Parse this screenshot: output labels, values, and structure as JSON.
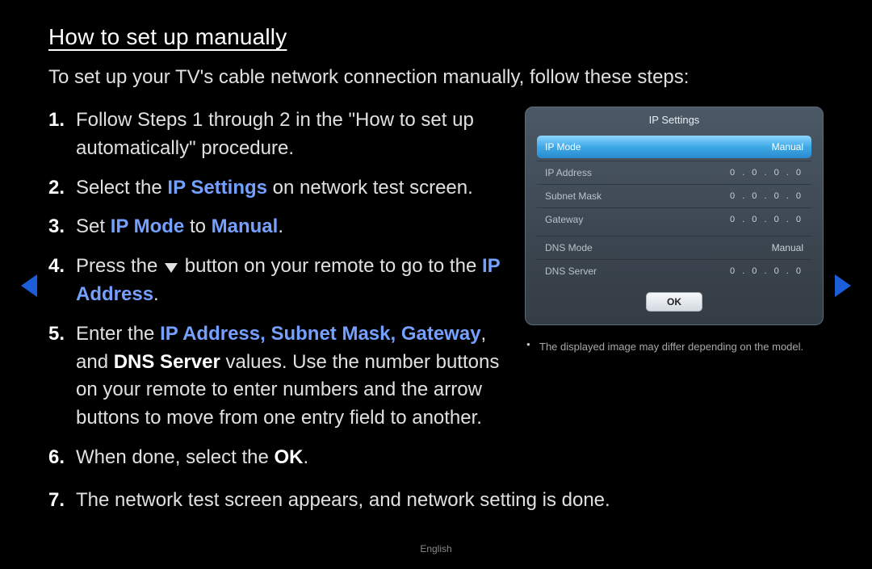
{
  "title": "How to set up manually",
  "intro": "To set up your TV's cable network connection manually, follow these steps:",
  "steps": {
    "s1": {
      "num": "1.",
      "a": "Follow Steps 1 through 2 in the \"How to set up automatically\" procedure."
    },
    "s2": {
      "num": "2.",
      "a": "Select the ",
      "hl": "IP Settings",
      "b": " on network test screen."
    },
    "s3": {
      "num": "3.",
      "a": "Set ",
      "hl1": "IP Mode",
      "b": " to ",
      "hl2": "Manual",
      "c": "."
    },
    "s4": {
      "num": "4.",
      "a": "Press the ",
      "b": " button on your remote to go to the ",
      "hl": "IP Address",
      "c": "."
    },
    "s5": {
      "num": "5.",
      "a": "Enter the ",
      "hl1": "IP Address, Subnet Mask, Gateway",
      "b": ", and ",
      "bold1": "DNS Server",
      "c": " values. Use the number buttons on your remote to enter numbers and the arrow buttons to move from one entry field to another."
    },
    "s6": {
      "num": "6.",
      "a": "When done, select the ",
      "bold": "OK",
      "b": "."
    },
    "s7": {
      "num": "7.",
      "a": "The network test screen appears, and network setting is done."
    }
  },
  "panel": {
    "title": "IP Settings",
    "rows": {
      "ip_mode": {
        "label": "IP Mode",
        "value": "Manual"
      },
      "ip_addr": {
        "label": "IP Address",
        "value": "0 . 0 . 0 . 0"
      },
      "subnet": {
        "label": "Subnet Mask",
        "value": "0 . 0 . 0 . 0"
      },
      "gateway": {
        "label": "Gateway",
        "value": "0 . 0 . 0 . 0"
      },
      "dns_mode": {
        "label": "DNS Mode",
        "value": "Manual"
      },
      "dns_server": {
        "label": "DNS Server",
        "value": "0 . 0 . 0 . 0"
      }
    },
    "ok": "OK"
  },
  "note": "The displayed image may differ depending on the model.",
  "footer": "English"
}
